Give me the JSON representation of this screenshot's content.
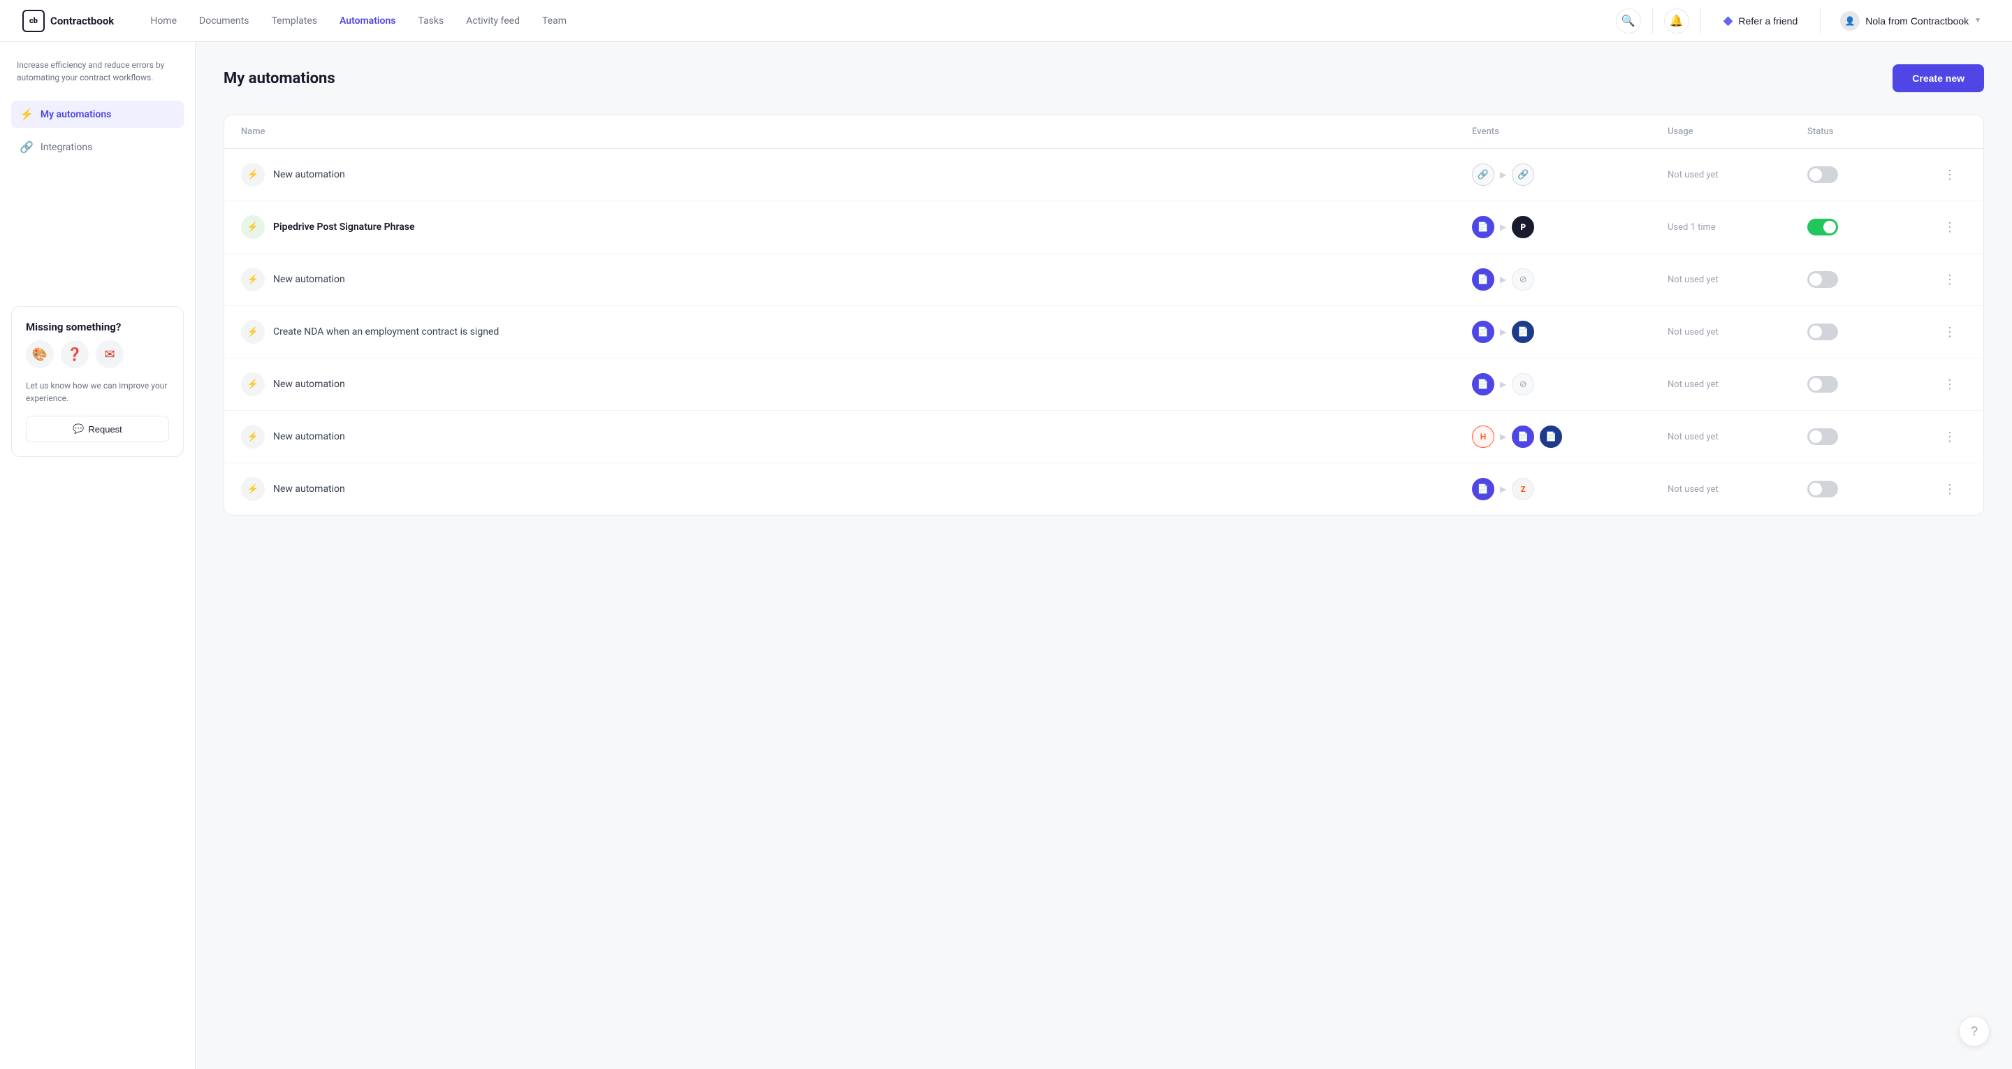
{
  "nav": {
    "logo_text": "Contractbook",
    "links": [
      {
        "label": "Home",
        "active": false
      },
      {
        "label": "Documents",
        "active": false
      },
      {
        "label": "Templates",
        "active": false
      },
      {
        "label": "Automations",
        "active": true
      },
      {
        "label": "Tasks",
        "active": false
      },
      {
        "label": "Activity feed",
        "active": false
      },
      {
        "label": "Team",
        "active": false
      }
    ],
    "refer_label": "Refer a friend",
    "user_label": "Nola from Contractbook"
  },
  "sidebar": {
    "description": "Increase efficiency and reduce errors by automating your contract workflows.",
    "items": [
      {
        "label": "My automations",
        "active": true,
        "icon": "⚡"
      },
      {
        "label": "Integrations",
        "active": false,
        "icon": "🔗"
      }
    ],
    "missing": {
      "title": "Missing something?",
      "desc": "Let us know how we can improve your experience.",
      "icons": [
        "🎨",
        "❓",
        "✉️"
      ],
      "btn_label": "Request"
    }
  },
  "main": {
    "title": "My automations",
    "create_btn": "Create new",
    "table": {
      "columns": [
        "Name",
        "Events",
        "Usage",
        "Status",
        ""
      ],
      "rows": [
        {
          "name": "New automation",
          "bold": false,
          "active_icon": false,
          "events": {
            "from": "link",
            "to": "link"
          },
          "usage": "Not used yet",
          "enabled": false
        },
        {
          "name": "Pipedrive Post Signature Phrase",
          "bold": true,
          "active_icon": true,
          "events": {
            "from": "doc-blue",
            "to": "pipedrive"
          },
          "usage": "Used 1 time",
          "enabled": true
        },
        {
          "name": "New automation",
          "bold": false,
          "active_icon": false,
          "events": {
            "from": "doc-blue",
            "to": "ban"
          },
          "usage": "Not used yet",
          "enabled": false
        },
        {
          "name": "Create NDA when an employment contract is signed",
          "bold": false,
          "active_icon": false,
          "events": {
            "from": "doc-blue",
            "to": "doc-dark"
          },
          "usage": "Not used yet",
          "enabled": false
        },
        {
          "name": "New automation",
          "bold": false,
          "active_icon": false,
          "events": {
            "from": "doc-blue",
            "to": "ban"
          },
          "usage": "Not used yet",
          "enabled": false
        },
        {
          "name": "New automation",
          "bold": false,
          "active_icon": false,
          "events": {
            "from": "hubspot",
            "to": "doc-blue doc-blue"
          },
          "usage": "Not used yet",
          "enabled": false
        },
        {
          "name": "New automation",
          "bold": false,
          "active_icon": false,
          "events": {
            "from": "doc-blue",
            "to": "zapier"
          },
          "usage": "Not used yet",
          "enabled": false
        }
      ]
    }
  }
}
